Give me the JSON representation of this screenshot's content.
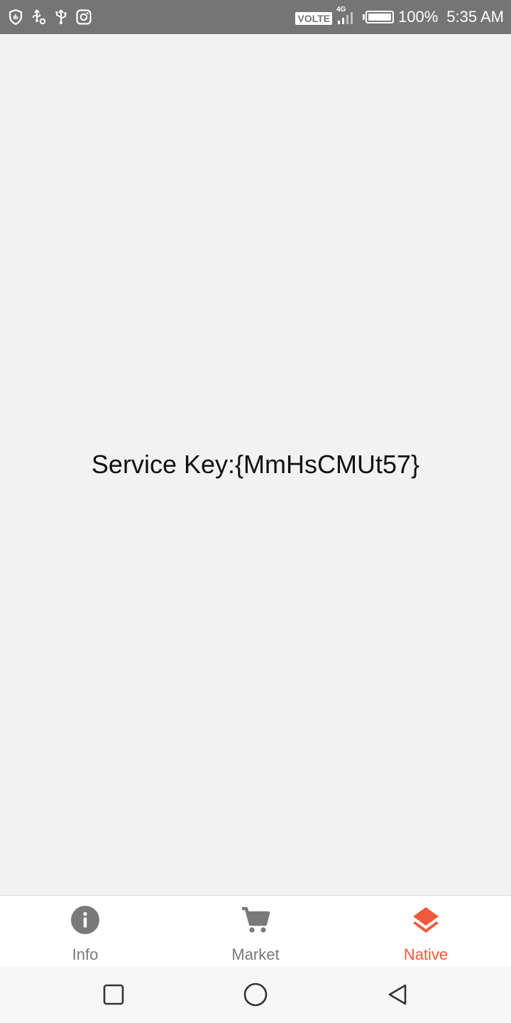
{
  "status_bar": {
    "left_icons": [
      "shield-icon",
      "usb-settings-icon",
      "usb-icon",
      "instagram-icon"
    ],
    "volte": "VOLTE",
    "network": "4G",
    "battery_percent": "100%",
    "battery_level": 1.0,
    "time": "5:35 AM"
  },
  "main": {
    "service_key_text": "Service Key:{MmHsCMUt57}"
  },
  "tab_bar": {
    "tabs": [
      {
        "label": "Info",
        "icon": "info-icon",
        "active": false
      },
      {
        "label": "Market",
        "icon": "cart-icon",
        "active": false
      },
      {
        "label": "Native",
        "icon": "layers-icon",
        "active": true
      }
    ]
  },
  "nav_bar": {
    "buttons": [
      "recents-square-icon",
      "home-circle-icon",
      "back-triangle-icon"
    ]
  },
  "colors": {
    "status_bar_bg": "#757575",
    "accent": "#ee5a3b",
    "tab_inactive": "#7a7a7a",
    "background": "#f2f2f2"
  }
}
